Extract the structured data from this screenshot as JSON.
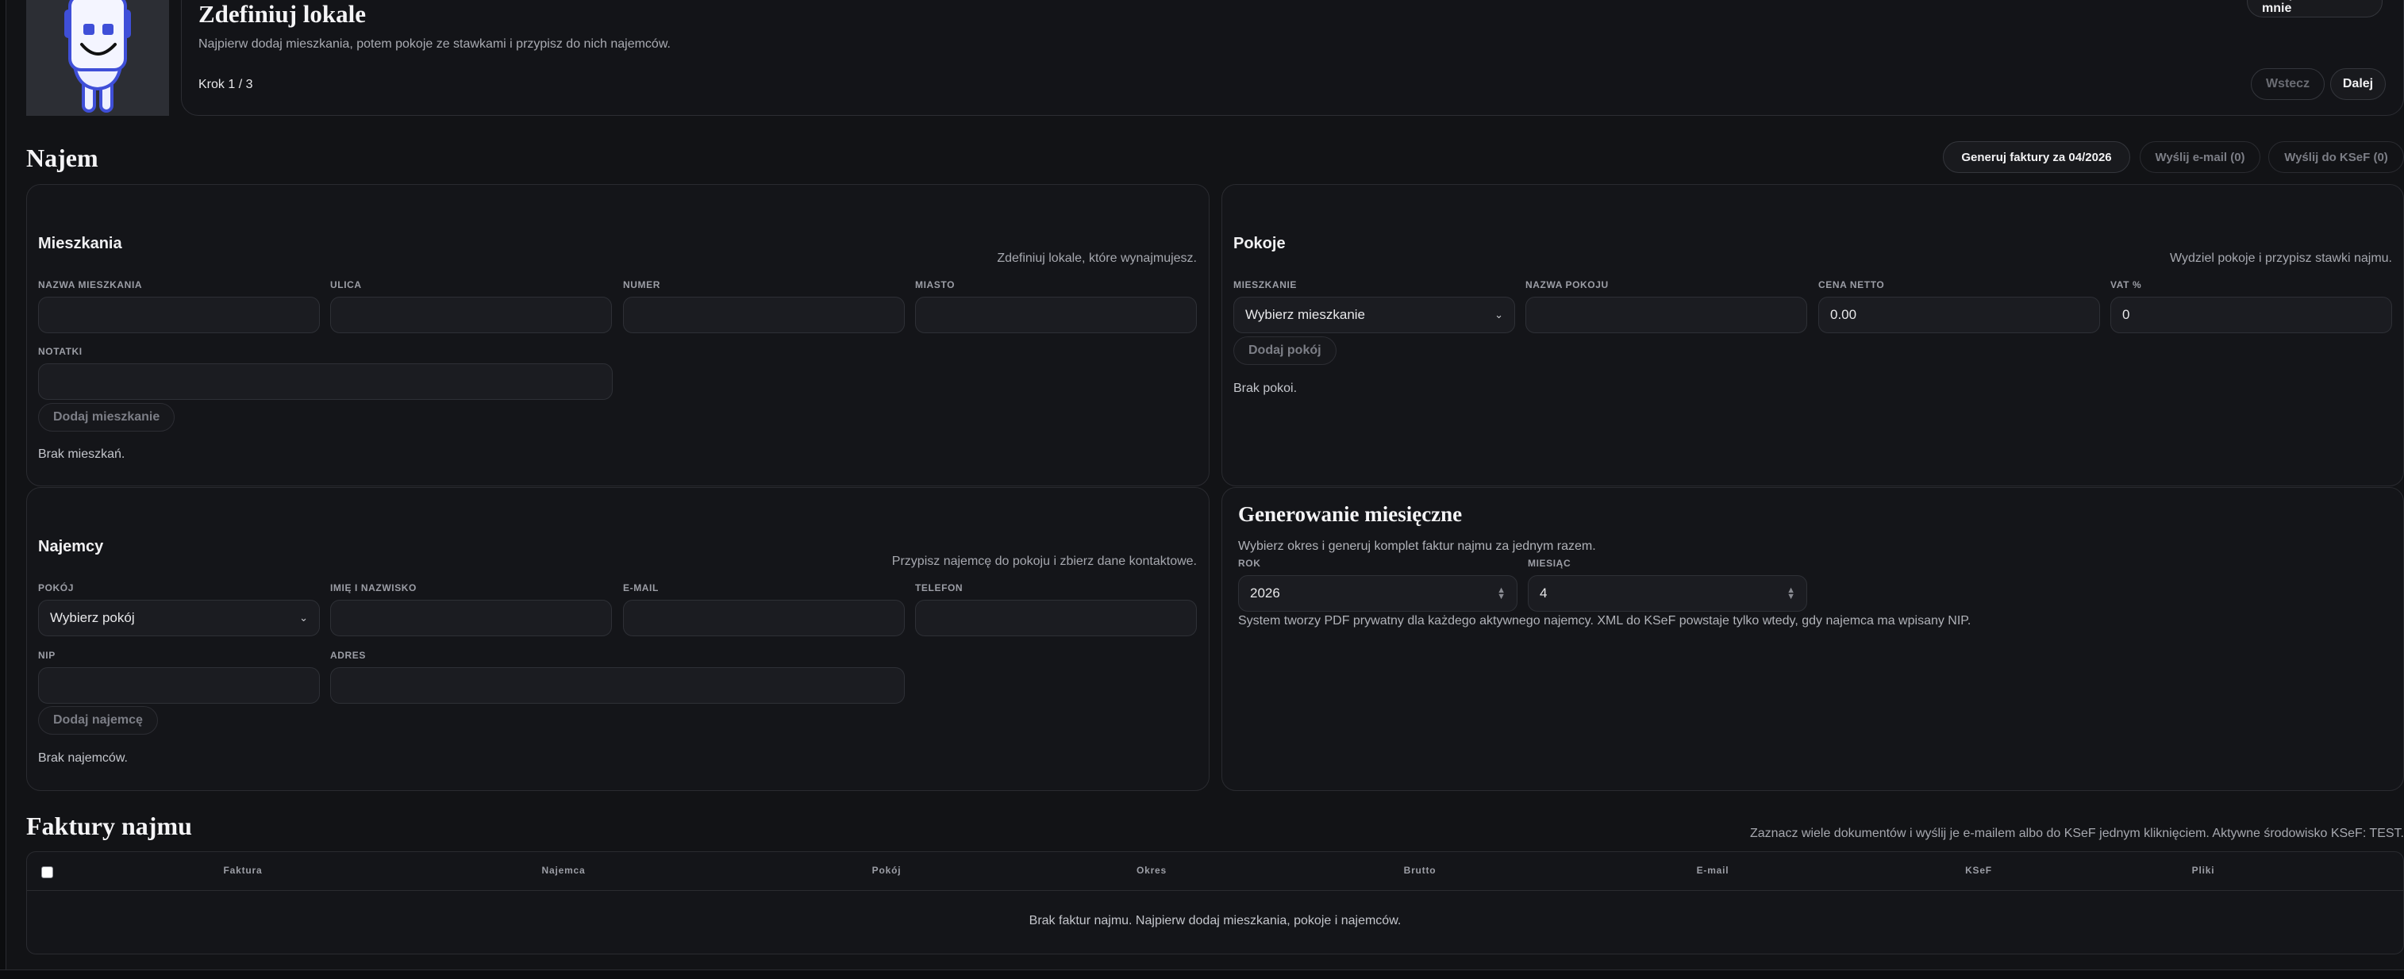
{
  "wizard": {
    "title": "Zdefiniuj lokale",
    "subtitle": "Najpierw dodaj mieszkania, potem pokoje ze stawkami i przypisz do nich najemców.",
    "step": "Krok 1 / 3",
    "guide_button": "Przeprowadź mnie",
    "back_button": "Wstecz",
    "next_button": "Dalej"
  },
  "najem": {
    "heading": "Najem",
    "generate_button": "Generuj faktury za 04/2026",
    "email_button": "Wyślij e-mail (0)",
    "ksef_button": "Wyślij do KSeF (0)"
  },
  "apartments": {
    "title": "Mieszkania",
    "hint": "Zdefiniuj lokale, które wynajmujesz.",
    "labels": {
      "name": "Nazwa mieszkania",
      "street": "Ulica",
      "number": "Numer",
      "city": "Miasto",
      "notes": "Notatki"
    },
    "add_button": "Dodaj mieszkanie",
    "empty": "Brak mieszkań."
  },
  "rooms": {
    "title": "Pokoje",
    "hint": "Wydziel pokoje i przypisz stawki najmu.",
    "labels": {
      "apartment": "Mieszkanie",
      "room_name": "Nazwa pokoju",
      "net_price": "Cena netto",
      "vat": "VAT %"
    },
    "apartment_select": "Wybierz mieszkanie",
    "net_price_value": "0.00",
    "vat_value": "0",
    "add_button": "Dodaj pokój",
    "empty": "Brak pokoi."
  },
  "tenants": {
    "title": "Najemcy",
    "hint": "Przypisz najemcę do pokoju i zbierz dane kontaktowe.",
    "labels": {
      "room": "Pokój",
      "full_name": "Imię i nazwisko",
      "email": "E-mail",
      "phone": "Telefon",
      "nip": "NIP",
      "address": "Adres"
    },
    "room_select": "Wybierz pokój",
    "add_button": "Dodaj najemcę",
    "empty": "Brak najemców."
  },
  "monthly": {
    "title": "Generowanie miesięczne",
    "subtitle": "Wybierz okres i generuj komplet faktur najmu za jednym razem.",
    "year_label": "Rok",
    "month_label": "Miesiąc",
    "year_value": "2026",
    "month_value": "4",
    "note": "System tworzy PDF prywatny dla każdego aktywnego najemcy. XML do KSeF powstaje tylko wtedy, gdy najemca ma wpisany NIP."
  },
  "invoices": {
    "heading": "Faktury najmu",
    "hint": "Zaznacz wiele dokumentów i wyślij je e-mailem albo do KSeF jednym kliknięciem. Aktywne środowisko KSeF: TEST.",
    "columns": [
      "Faktura",
      "Najemca",
      "Pokój",
      "Okres",
      "Brutto",
      "E-mail",
      "KSeF",
      "Pliki"
    ],
    "empty": "Brak faktur najmu. Najpierw dodaj mieszkania, pokoje i najemców."
  },
  "colors": {
    "background": "#121316",
    "card": "#141519",
    "border": "#2a2b30",
    "robot_blue": "#3f4fd8"
  }
}
